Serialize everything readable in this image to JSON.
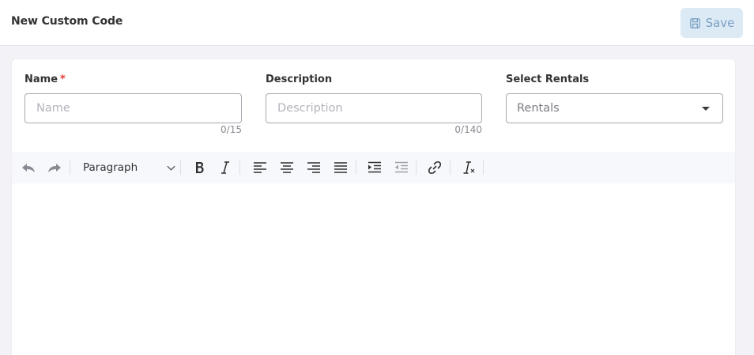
{
  "header": {
    "title": "New Custom Code",
    "save_label": "Save"
  },
  "form": {
    "name": {
      "label": "Name",
      "required_mark": "*",
      "placeholder": "Name",
      "value": "",
      "counter": "0/15"
    },
    "description": {
      "label": "Description",
      "placeholder": "Description",
      "value": "",
      "counter": "0/140"
    },
    "rentals": {
      "label": "Select Rentals",
      "selected": "Rentals"
    }
  },
  "toolbar": {
    "block_format": "Paragraph",
    "icons": [
      "undo-icon",
      "redo-icon",
      "bold-icon",
      "italic-icon",
      "align-left-icon",
      "align-center-icon",
      "align-right-icon",
      "align-justify-icon",
      "indent-icon",
      "outdent-icon",
      "link-icon",
      "clear-formatting-icon"
    ]
  },
  "colors": {
    "save_bg": "#dceaf5",
    "save_text": "#7a9fc2",
    "required": "#e53935",
    "toolbar_bg": "#f7f8fc"
  }
}
